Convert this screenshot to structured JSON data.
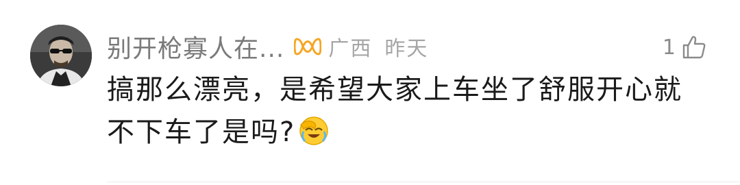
{
  "comment": {
    "username": "别开枪寡人在...",
    "badge_icon": "vip-badge-icon",
    "location": "广西",
    "time": "昨天",
    "like_count": "1",
    "text_line1": "搞那么漂亮，是希望大家上车坐了舒服开心就",
    "text_line2": "不下车了是吗?",
    "emoji": "facepalm-laugh-emoji",
    "colors": {
      "username": "#7a7a7a",
      "meta": "#a6a6a6",
      "body_text": "#1a1a1a",
      "badge": "#f5a623",
      "divider": "#ececec"
    }
  }
}
